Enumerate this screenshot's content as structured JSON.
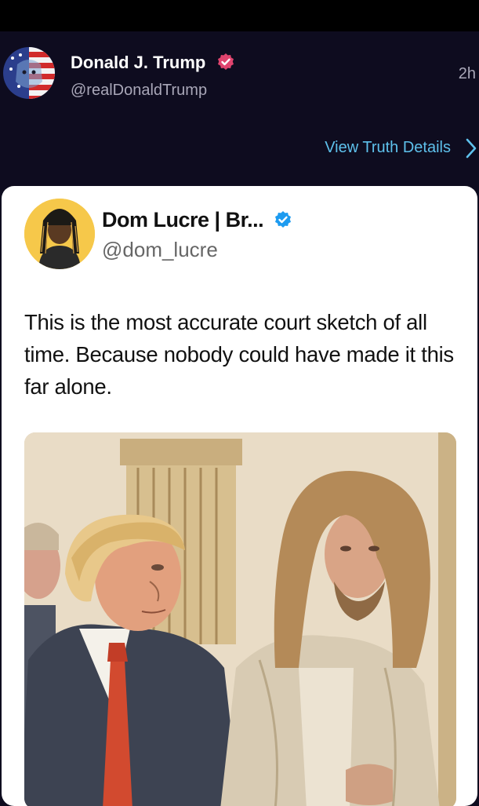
{
  "post": {
    "author_name": "Donald J. Trump",
    "author_handle": "@realDonaldTrump",
    "time": "2h",
    "details_link": "View Truth Details"
  },
  "quoted": {
    "author_name": "Dom Lucre | Br...",
    "author_handle": "@dom_lucre",
    "text": "This is the most accurate court sketch of all time. Because nobody could have made it this far alone."
  },
  "colors": {
    "background": "#0e0c1f",
    "link": "#5ec1ec",
    "verified_pink": "#e0446e",
    "verified_blue": "#1d9bf0"
  },
  "icons": [
    "verified-badge-icon",
    "chevron-right-icon"
  ]
}
